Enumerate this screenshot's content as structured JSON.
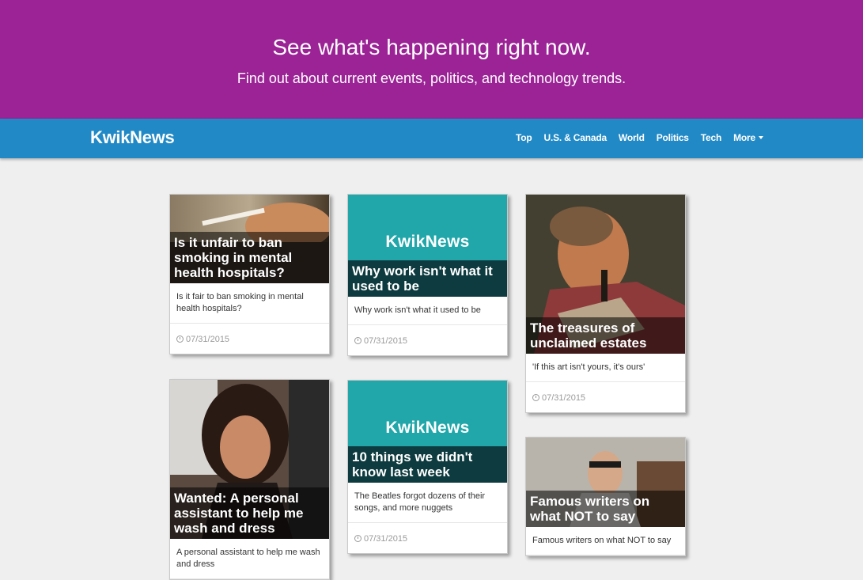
{
  "hero": {
    "title": "See what's happening right now.",
    "subtitle": "Find out about current events, politics, and technology trends."
  },
  "nav": {
    "brand": "KwikNews",
    "links": [
      "Top",
      "U.S. & Canada",
      "World",
      "Politics",
      "Tech",
      "More"
    ]
  },
  "colors": {
    "hero_bg": "#9b2396",
    "nav_bg": "#2189c6",
    "teal_placeholder": "#21a7aa"
  },
  "cards": [
    {
      "title": "Is it unfair to ban smoking in mental health hospitals?",
      "summary": "Is it fair to ban smoking in mental health hospitals?",
      "date": "07/31/2015",
      "image": "cigarette-photo"
    },
    {
      "title": "Why work isn't what it used to be",
      "summary": "Why work isn't what it used to be",
      "date": "07/31/2015",
      "image": "kwiknews-logo",
      "logo_text": "KwikNews"
    },
    {
      "title": "The treasures of unclaimed estates",
      "summary": "'If this art isn't yours, it's ours'",
      "date": "07/31/2015",
      "image": "portrait-painting"
    },
    {
      "title": "Wanted: A personal assistant to help me wash and dress",
      "summary": "A personal assistant to help me wash and dress",
      "image": "woman-photo"
    },
    {
      "title": "10 things we didn't know last week",
      "summary": "The Beatles forgot dozens of their songs, and more nuggets",
      "date": "07/31/2015",
      "image": "kwiknews-logo",
      "logo_text": "KwikNews"
    },
    {
      "title": "Famous writers on what NOT to say",
      "summary": "Famous writers on what NOT to say",
      "image": "writer-photo"
    }
  ]
}
